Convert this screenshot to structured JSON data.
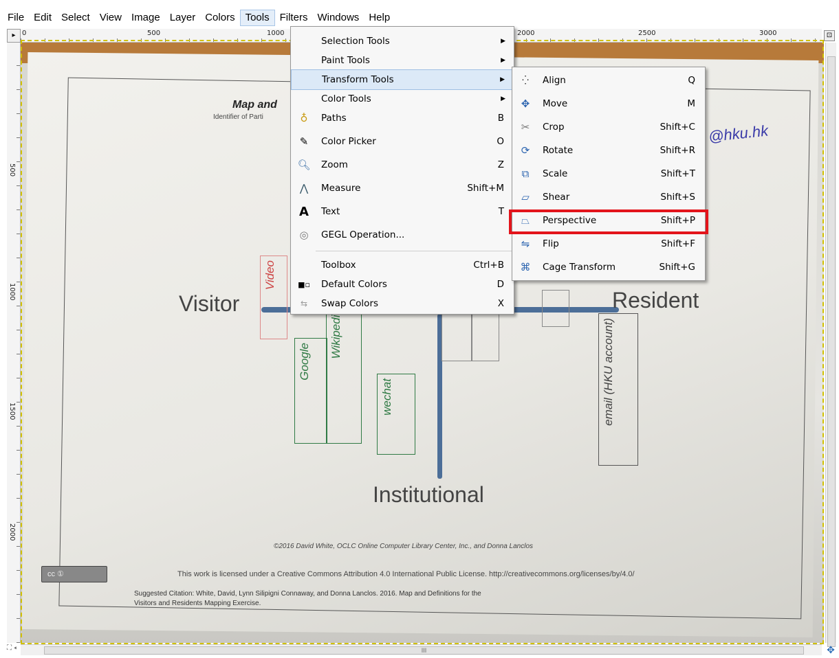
{
  "menubar": {
    "items": [
      {
        "label": "File"
      },
      {
        "label": "Edit"
      },
      {
        "label": "Select"
      },
      {
        "label": "View"
      },
      {
        "label": "Image"
      },
      {
        "label": "Layer"
      },
      {
        "label": "Colors"
      },
      {
        "label": "Tools"
      },
      {
        "label": "Filters"
      },
      {
        "label": "Windows"
      },
      {
        "label": "Help"
      }
    ]
  },
  "ruler": {
    "top_marks": [
      "0",
      "500",
      "1000",
      "2000",
      "2500",
      "3000"
    ],
    "left_marks": [
      "500",
      "1000",
      "1500",
      "2000"
    ]
  },
  "tools_menu": {
    "items": [
      {
        "label": "Selection Tools",
        "shortcut": "",
        "submenu": true,
        "icon": ""
      },
      {
        "label": "Paint Tools",
        "shortcut": "",
        "submenu": true,
        "icon": ""
      },
      {
        "label": "Transform Tools",
        "shortcut": "",
        "submenu": true,
        "icon": "",
        "highlighted": true
      },
      {
        "label": "Color Tools",
        "shortcut": "",
        "submenu": true,
        "icon": ""
      },
      {
        "label": "Paths",
        "shortcut": "B",
        "icon": "paths-icon"
      },
      {
        "label": "Color Picker",
        "shortcut": "O",
        "icon": "color-picker-icon"
      },
      {
        "label": "Zoom",
        "shortcut": "Z",
        "icon": "zoom-icon"
      },
      {
        "label": "Measure",
        "shortcut": "Shift+M",
        "icon": "measure-icon"
      },
      {
        "label": "Text",
        "shortcut": "T",
        "icon": "text-icon"
      },
      {
        "label": "GEGL Operation...",
        "shortcut": "",
        "icon": "gegl-icon"
      },
      {
        "label": "Toolbox",
        "shortcut": "Ctrl+B",
        "icon": ""
      },
      {
        "label": "Default Colors",
        "shortcut": "D",
        "icon": "default-colors-icon"
      },
      {
        "label": "Swap Colors",
        "shortcut": "X",
        "icon": "swap-colors-icon"
      }
    ]
  },
  "transform_menu": {
    "items": [
      {
        "label": "Align",
        "shortcut": "Q",
        "icon": "align-icon"
      },
      {
        "label": "Move",
        "shortcut": "M",
        "icon": "move-icon"
      },
      {
        "label": "Crop",
        "shortcut": "Shift+C",
        "icon": "crop-icon"
      },
      {
        "label": "Rotate",
        "shortcut": "Shift+R",
        "icon": "rotate-icon"
      },
      {
        "label": "Scale",
        "shortcut": "Shift+T",
        "icon": "scale-icon"
      },
      {
        "label": "Shear",
        "shortcut": "Shift+S",
        "icon": "shear-icon"
      },
      {
        "label": "Perspective",
        "shortcut": "Shift+P",
        "icon": "perspective-icon",
        "emphasized": true
      },
      {
        "label": "Flip",
        "shortcut": "Shift+F",
        "icon": "flip-icon"
      },
      {
        "label": "Cage Transform",
        "shortcut": "Shift+G",
        "icon": "cage-transform-icon"
      }
    ]
  },
  "image": {
    "title": "Map and",
    "subtitle": "Identifier of Parti",
    "left_label": "Visitor",
    "right_label": "Resident",
    "bottom_label": "Institutional",
    "handwritten_email": "@hku.hk",
    "notes": [
      "Video",
      "Google",
      "Wikipedia",
      "wechat",
      "email (HKU account)"
    ],
    "copyright": "©2016 David White, OCLC Online Computer Library Center, Inc., and Donna Lanclos",
    "license_line": "This work is licensed under a Creative Commons Attribution 4.0 International Public License. http://creativecommons.org/licenses/by/4.0/",
    "citation_1": "Suggested Citation: White, David, Lynn Silipigni Connaway, and Donna Lanclos. 2016. Map and Definitions for the",
    "citation_2": "Visitors and Residents Mapping Exercise.",
    "cc_badge": "cc  ①"
  },
  "scrollbar": {
    "h_label": "III"
  },
  "colors": {
    "highlight_box": "#e3141b",
    "axis": "#4c6e98",
    "menu_highlight": "#dce9f7"
  }
}
